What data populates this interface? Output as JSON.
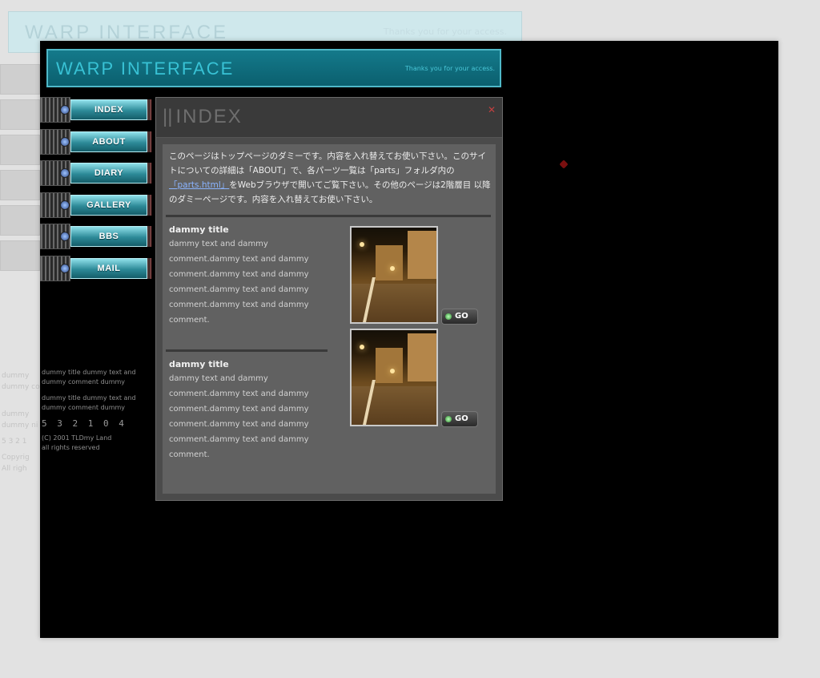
{
  "ghost": {
    "title": "WARP INTERFACE",
    "tagline": "Thanks you for your access.",
    "notes": [
      "dummy",
      "dummy co",
      "dummy",
      "dummy ni",
      "5 3 2 1",
      "Copyrig",
      "All righ"
    ]
  },
  "header": {
    "title": "WARP INTERFACE",
    "tagline": "Thanks you for your access."
  },
  "menu": {
    "items": [
      {
        "label": "INDEX",
        "icon": "knob-icon"
      },
      {
        "label": "ABOUT",
        "icon": "knob-icon"
      },
      {
        "label": "DIARY",
        "icon": "knob-icon"
      },
      {
        "label": "GALLERY",
        "icon": "knob-icon"
      },
      {
        "label": "BBS",
        "icon": "knob-icon"
      },
      {
        "label": "MAIL",
        "icon": "knob-icon"
      }
    ]
  },
  "side_notes": {
    "note1": "dummy title dummy text and dummy comment dummy",
    "note2": "dummy title dummy text and dummy comment dummy",
    "counter": "5 3 2 1 0 4",
    "copyright": "(C) 2001 TLDmy Land",
    "rights": "all rights reserved"
  },
  "panel": {
    "title": "INDEX",
    "close_icon": "close-icon",
    "intro_part1": "このページはトップページのダミーです。内容を入れ替えてお使い下さい。このサイトについての詳細は「ABOUT」で、各パーツ一覧は「parts」フォルダ内の",
    "intro_link": "「parts.html」",
    "intro_part2": "をWebブラウザで開いてご覧下さい。その他のページは2階層目 以降のダミーページです。内容を入れ替えてお使い下さい。",
    "entries": [
      {
        "title": "dammy title",
        "text": "dammy text and dammy comment.dammy text and dammy comment.dammy text and dammy comment.dammy text and dammy comment.dammy text and dammy comment.",
        "go_label": "GO"
      },
      {
        "title": "dammy title",
        "text": "dammy text and dammy comment.dammy text and dammy comment.dammy text and dammy comment.dammy text and dammy comment.dammy text and dammy comment.",
        "go_label": "GO"
      }
    ]
  },
  "colors": {
    "header_bg": "#147a8b",
    "header_text": "#38c2d5",
    "panel_bg": "#616161",
    "window_bg": "#000000"
  }
}
